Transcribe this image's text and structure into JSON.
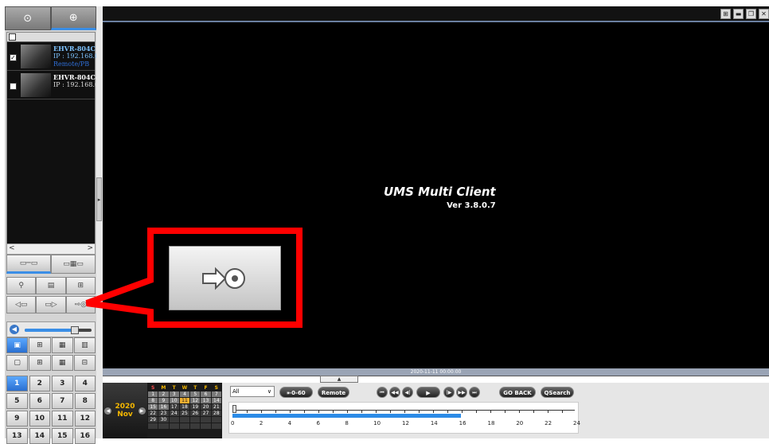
{
  "left_panel": {
    "top_tabs": [
      {
        "icon": "site-icon",
        "glyph": "⊙"
      },
      {
        "icon": "search-icon",
        "glyph": "⊕"
      }
    ],
    "devices": [
      {
        "name": "EHVR-804C",
        "ip": "IP : 192.168.0",
        "status": "Remote/PB",
        "checked": true
      },
      {
        "name": "EHVR-804C-",
        "ip": "IP : 192.168.0",
        "status": "",
        "checked": false
      }
    ],
    "scroll_left": "<",
    "scroll_right": ">",
    "icons_row1": [
      "network-icon",
      "tree-icon"
    ],
    "icons_row2": [
      "user-icon",
      "log-icon",
      "tree-view-icon"
    ],
    "icons_row3": [
      "connect-left-icon",
      "connect-right-icon",
      "disconnect-icon"
    ],
    "volume": 0.75,
    "layouts_row1": [
      "1x1",
      "2x2",
      "3x3",
      "4x4"
    ],
    "layouts_row2": [
      "single",
      "split-a",
      "split-b",
      "split-c"
    ],
    "channels": [
      "1",
      "2",
      "3",
      "4",
      "5",
      "6",
      "7",
      "8",
      "9",
      "10",
      "11",
      "12",
      "13",
      "14",
      "15",
      "16"
    ],
    "active_channel": "1"
  },
  "main": {
    "window_controls": [
      "⊞",
      "▬",
      "❐",
      "✕"
    ],
    "app_title": "UMS Multi Client",
    "version": "Ver 3.8.0.7"
  },
  "timeline": {
    "timestamp": "2020-11-11 00:00:00",
    "calendar": {
      "year": "2020",
      "month": "Nov",
      "day_headers": [
        "S",
        "M",
        "T",
        "W",
        "T",
        "F",
        "S"
      ],
      "days": [
        "1",
        "2",
        "3",
        "4",
        "5",
        "6",
        "7",
        "8",
        "9",
        "10",
        "11",
        "12",
        "13",
        "14",
        "15",
        "16",
        "17",
        "18",
        "19",
        "20",
        "21",
        "22",
        "23",
        "24",
        "25",
        "26",
        "27",
        "28",
        "29",
        "30"
      ]
    },
    "channel_select": "All",
    "jump_label": "⇤0-60",
    "remote_log_label": "Remote Log",
    "playback_buttons": [
      "⏮",
      "◀◀",
      "◀|",
      "▶",
      "|▶",
      "▶▶",
      "⏭"
    ],
    "go_back_label": "GO BACK",
    "search_label": "QSearch",
    "ruler_labels": [
      "0",
      "2",
      "4",
      "6",
      "8",
      "10",
      "12",
      "14",
      "16",
      "18",
      "20",
      "22",
      "24"
    ],
    "recorded_until_hour": 16
  },
  "callout": {
    "highlight_color": "#ff0000",
    "icon": "disconnect-icon"
  }
}
